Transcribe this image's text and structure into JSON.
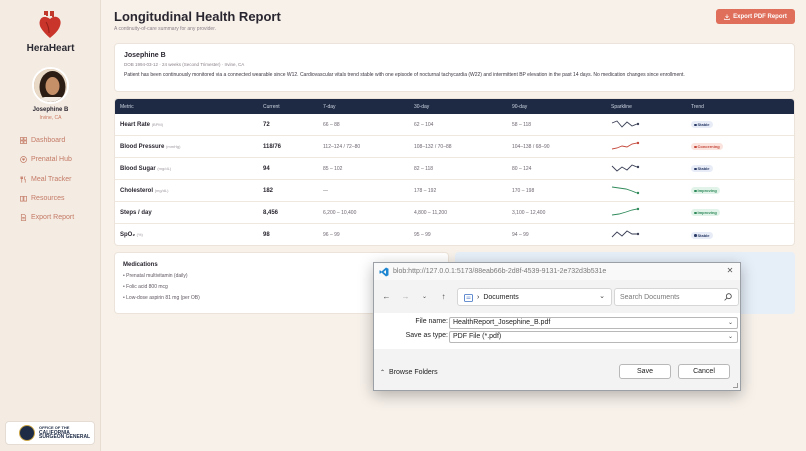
{
  "sidebar": {
    "brand": "HeraHeart",
    "user_name": "Josephine B",
    "user_location": "Irvine, CA",
    "items": [
      {
        "label": "Dashboard",
        "icon": "grid-icon"
      },
      {
        "label": "Prenatal Hub",
        "icon": "heart-circle-icon"
      },
      {
        "label": "Meal Tracker",
        "icon": "utensils-icon"
      },
      {
        "label": "Resources",
        "icon": "book-icon"
      },
      {
        "label": "Export Report",
        "icon": "document-icon"
      }
    ],
    "badge": {
      "line1": "OFFICE OF THE",
      "line2": "CALIFORNIA",
      "line3": "SURGEON GENERAL"
    }
  },
  "header": {
    "title": "Longitudinal Health Report",
    "subtitle": "A continuity-of-care summary for any provider.",
    "export_label": "Export PDF Report"
  },
  "patient": {
    "name": "Josephine B",
    "meta": "DOB 1994-03-12 · 24 weeks (Second Trimester) · Irvine, CA",
    "summary": "Patient has been continuously monitored via a connected wearable since W12. Cardiovascular vitals trend stable with one episode of nocturnal tachycardia (W22) and intermittent BP elevation in the past 14 days. No medication changes since enrollment."
  },
  "table": {
    "headers": {
      "metric": "Metric",
      "current": "Current",
      "d7": "7-day",
      "d30": "30-day",
      "d90": "90-day",
      "spark": "Sparkline",
      "trend": "Trend"
    },
    "rows": [
      {
        "metric": "Heart Rate",
        "unit": "(BPM)",
        "current": "72",
        "d7": "66 – 88",
        "d30": "62 – 104",
        "d90": "58 – 118",
        "trend": "Stable",
        "status": "stable"
      },
      {
        "metric": "Blood Pressure",
        "unit": "(mmHg)",
        "current": "118/76",
        "d7": "112–124 / 72–80",
        "d30": "108–132 / 70–88",
        "d90": "104–138 / 68–90",
        "trend": "Concerning",
        "status": "concerning"
      },
      {
        "metric": "Blood Sugar",
        "unit": "(mg/dL)",
        "current": "94",
        "d7": "85 – 102",
        "d30": "82 – 118",
        "d90": "80 – 124",
        "trend": "Stable",
        "status": "stable"
      },
      {
        "metric": "Cholesterol",
        "unit": "(mg/dL)",
        "current": "182",
        "d7": "—",
        "d30": "178 – 192",
        "d90": "170 – 198",
        "trend": "Improving",
        "status": "improving"
      },
      {
        "metric": "Steps / day",
        "unit": "",
        "current": "8,456",
        "d7": "6,200 – 10,400",
        "d30": "4,800 – 11,200",
        "d90": "3,100 – 12,400",
        "trend": "Improving",
        "status": "improving"
      },
      {
        "metric": "SpO₂",
        "unit": "(%)",
        "current": "98",
        "d7": "96 – 99",
        "d30": "95 – 99",
        "d90": "94 – 99",
        "trend": "Stable",
        "status": "stable"
      }
    ]
  },
  "medications": {
    "title": "Medications",
    "items": [
      "Prenatal multivitamin (daily)",
      "Folic acid 800 mcg",
      "Low-dose aspirin 81 mg (per OB)"
    ]
  },
  "dialog": {
    "title": "blob:http://127.0.0.1:5173/88eab66b-2d8f-4539-9131-2e732d3b531e",
    "location": "Documents",
    "search_placeholder": "Search Documents",
    "file_name_label": "File name:",
    "file_name_value": "HealthReport_Josephine_B.pdf",
    "save_type_label": "Save as type:",
    "save_type_value": "PDF File (*.pdf)",
    "browse_label": "Browse Folders",
    "save_label": "Save",
    "cancel_label": "Cancel"
  },
  "colors": {
    "accent": "#df6f5b",
    "navy": "#1e2a44",
    "nav_text": "#c47a66"
  }
}
